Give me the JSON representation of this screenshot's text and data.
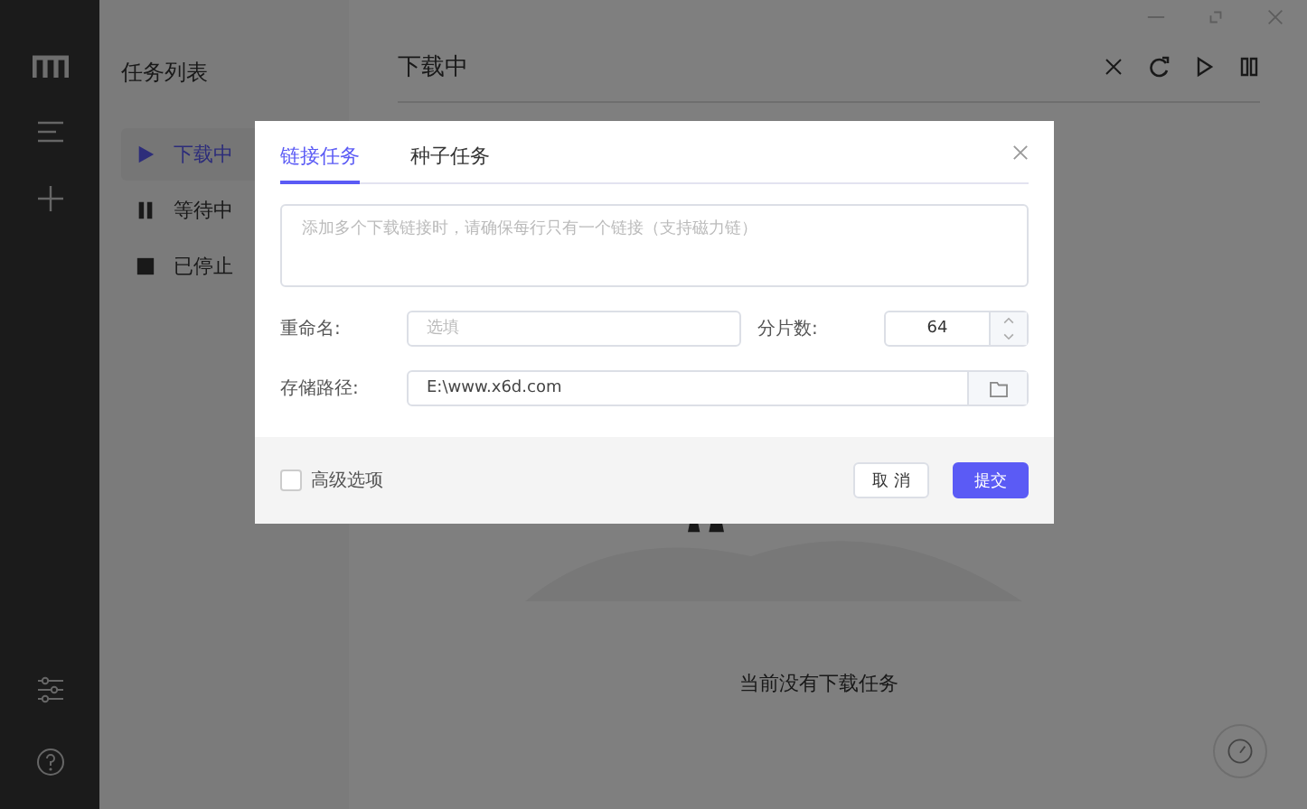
{
  "sidebar": {
    "icons": [
      {
        "kind": "logo"
      },
      {
        "kind": "menu"
      },
      {
        "kind": "add"
      },
      {
        "kind": "settings"
      },
      {
        "kind": "help"
      }
    ]
  },
  "task_list": {
    "title": "任务列表",
    "items": [
      {
        "label": "下载中",
        "kind": "play",
        "selected": true
      },
      {
        "label": "等待中",
        "kind": "pause",
        "selected": false
      },
      {
        "label": "已停止",
        "kind": "stop",
        "selected": false
      }
    ]
  },
  "main": {
    "title": "下载中",
    "toolbar": [
      {
        "kind": "close"
      },
      {
        "kind": "refresh"
      },
      {
        "kind": "play"
      },
      {
        "kind": "pause"
      }
    ],
    "empty_message": "当前没有下载任务"
  },
  "dialog": {
    "tabs": [
      {
        "label": "链接任务",
        "selected": true
      },
      {
        "label": "种子任务",
        "selected": false
      }
    ],
    "links": {
      "placeholder": "添加多个下载链接时，请确保每行只有一个链接（支持磁力链）"
    },
    "rename": {
      "label": "重命名:",
      "placeholder": "选填"
    },
    "split": {
      "label": "分片数:",
      "value": "64"
    },
    "path": {
      "label": "存储路径:",
      "value": "E:\\www.x6d.com"
    },
    "advanced": {
      "label": "高级选项",
      "checked": false
    },
    "buttons": [
      {
        "label": "取 消",
        "kind": "secondary"
      },
      {
        "label": "提交",
        "kind": "primary"
      }
    ]
  }
}
